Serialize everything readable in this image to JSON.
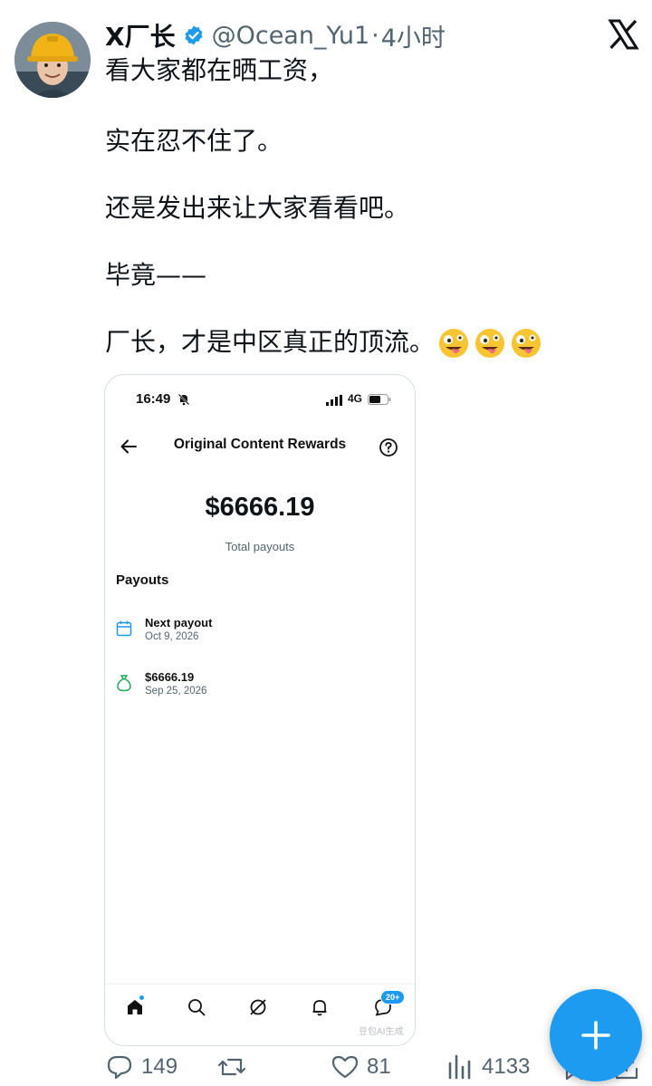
{
  "tweet": {
    "display_name": "X厂长",
    "handle": "@Ocean_Yu1",
    "separator": "·",
    "time": "4小时",
    "paragraphs": [
      "看大家都在晒工资，",
      "实在忍不住了。",
      "还是发出来让大家看看吧。",
      "毕竟——",
      "厂长，才是中区真正的顶流。"
    ],
    "emojis": [
      "zany-face-emoji",
      "zany-face-emoji",
      "zany-face-emoji"
    ]
  },
  "media": {
    "status_time": "16:49",
    "network": "4G",
    "title": "Original Content Rewards",
    "amount": "$6666.19",
    "amount_label": "Total payouts",
    "section": "Payouts",
    "rows": [
      {
        "title": "Next payout",
        "sub": "Oct 9, 2026",
        "icon": "calendar-icon"
      },
      {
        "title": "$6666.19",
        "sub": "Sep 25, 2026",
        "icon": "money-bag-icon"
      }
    ],
    "badge": "20+",
    "watermark": "豆包AI生成"
  },
  "actions": {
    "replies": "149",
    "reposts": "",
    "likes": "81",
    "views": "4133"
  },
  "colors": {
    "accent": "#1d9bf0",
    "text": "#0f1419",
    "secondary": "#536471"
  }
}
